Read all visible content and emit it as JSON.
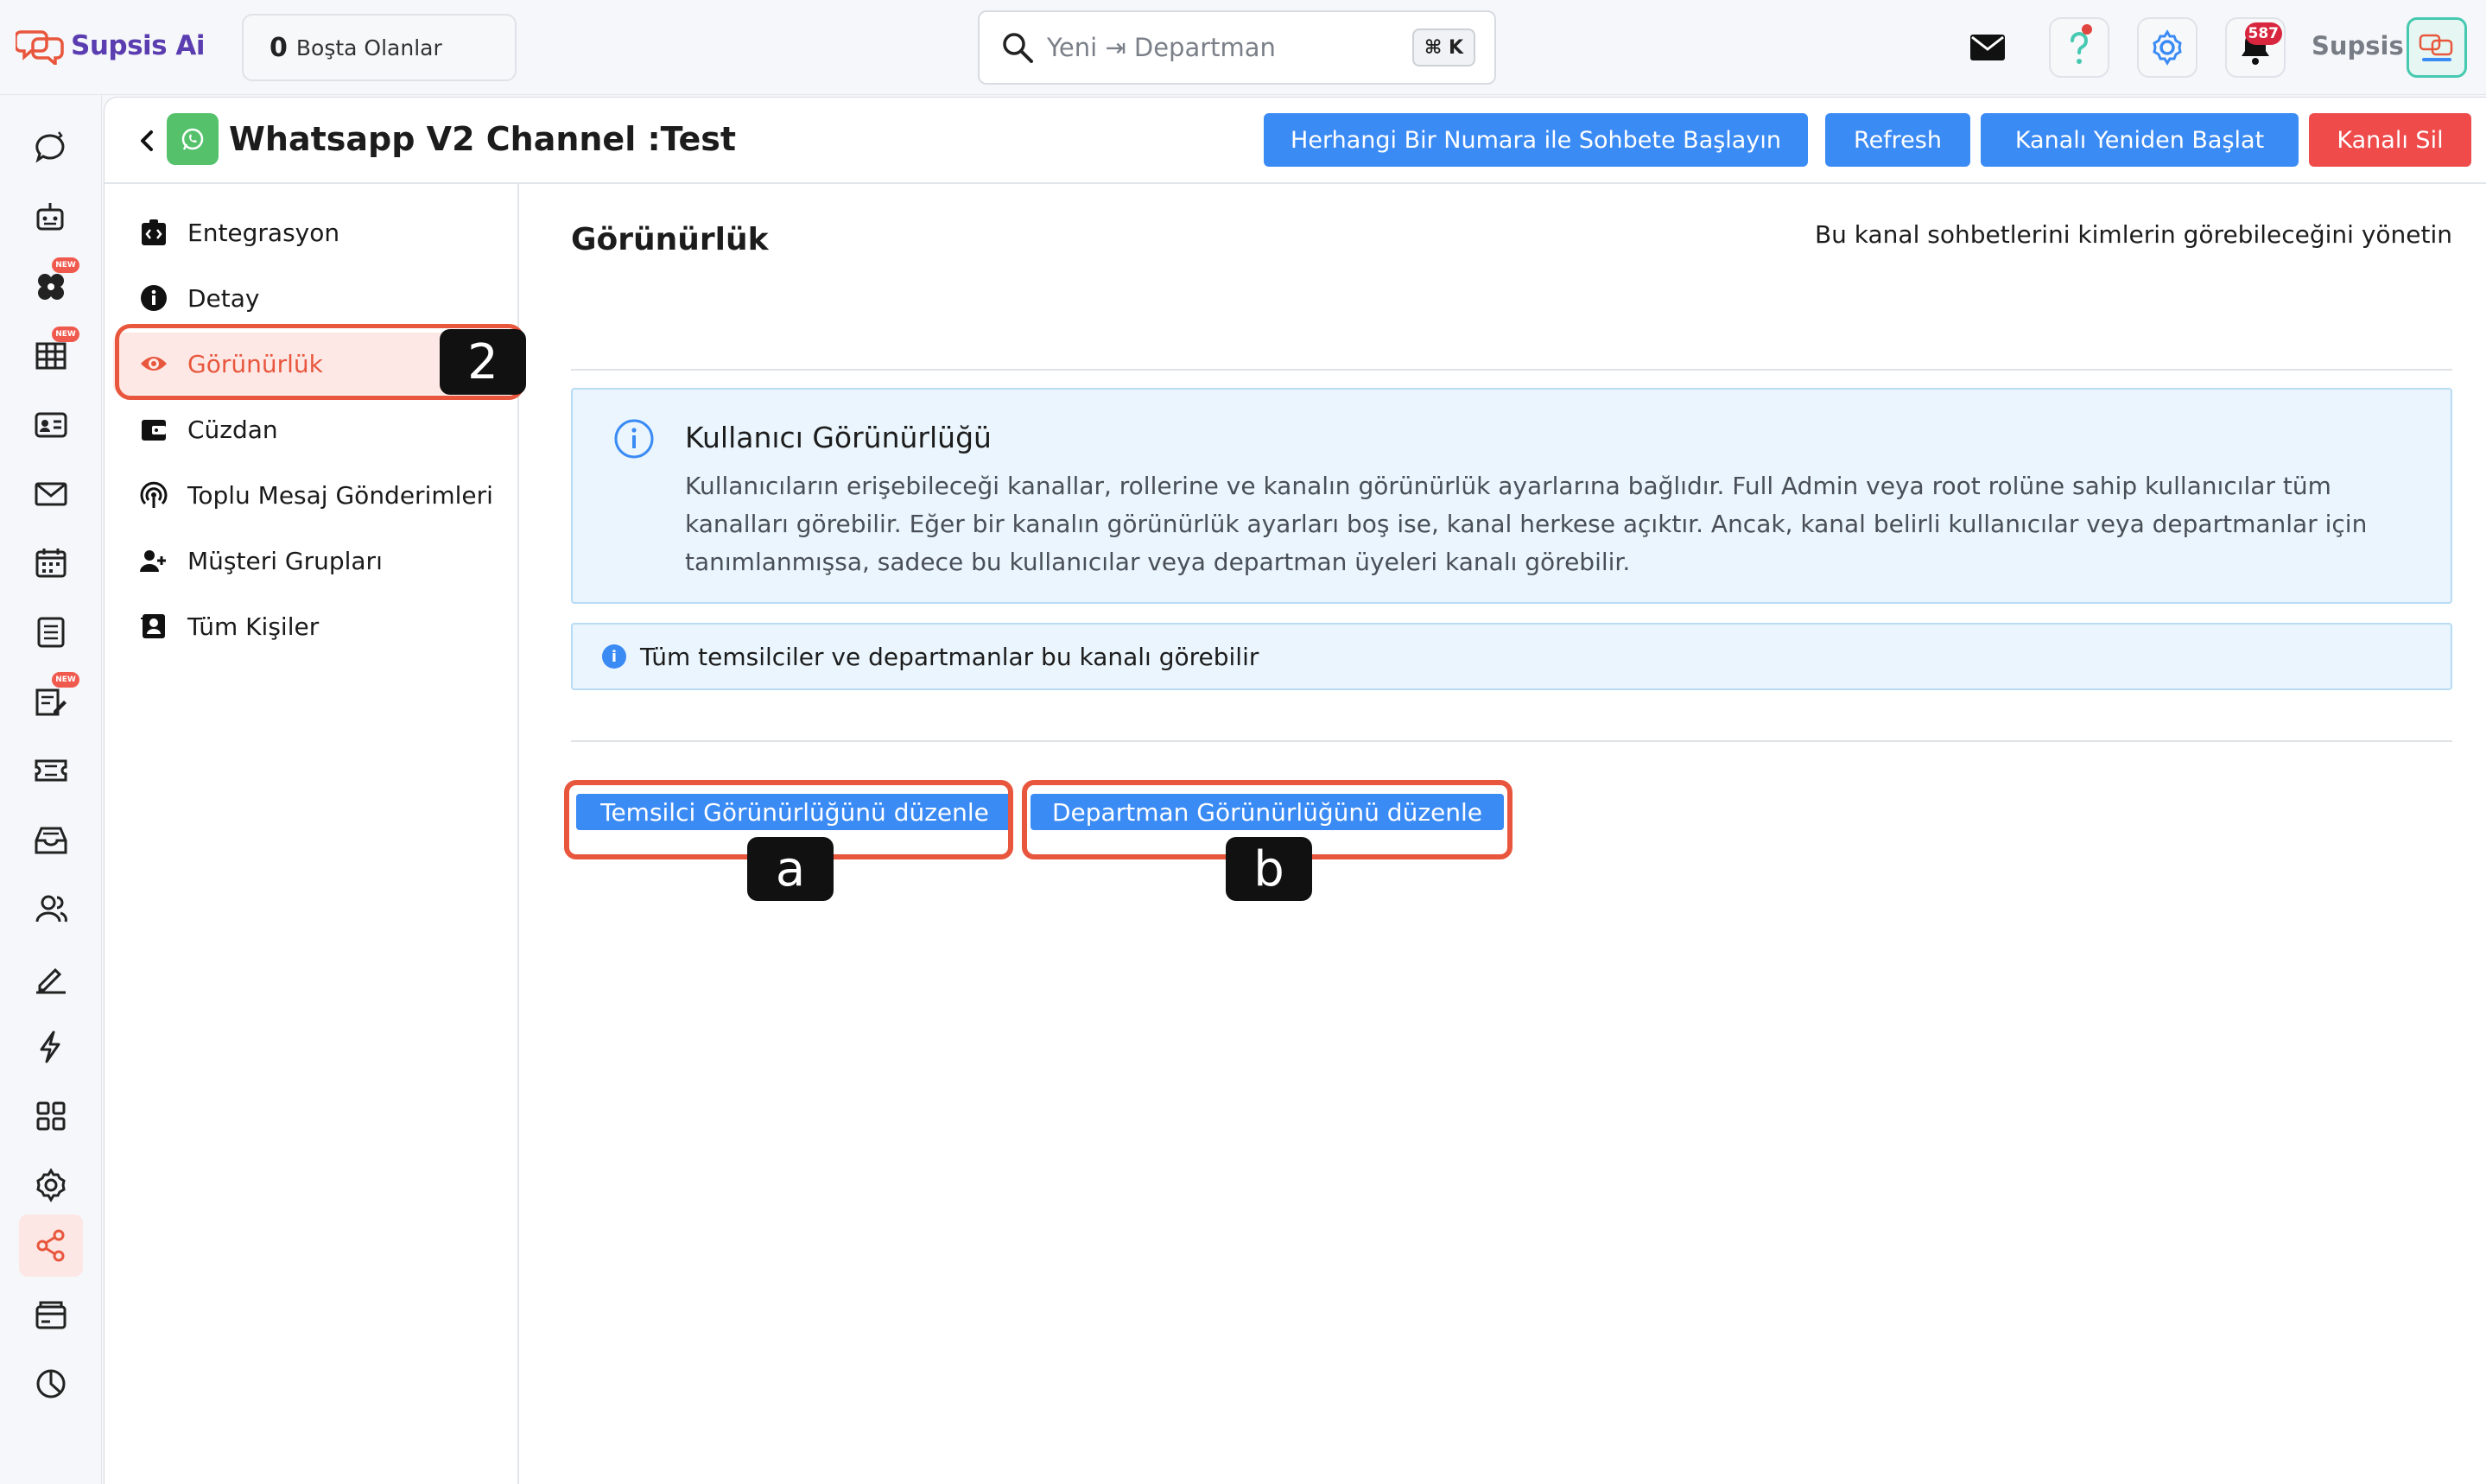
{
  "brand": {
    "name": "Supsis Ai"
  },
  "topbar": {
    "idle_count": "0",
    "idle_label": "Boşta Olanlar",
    "search_placeholder": "Yeni ⇥ Departman",
    "search_shortcut": "⌘ K",
    "notification_count": "587",
    "user_name": "Supsis"
  },
  "rail": {
    "items": [
      {
        "icon": "chat-bubble-icon"
      },
      {
        "icon": "bot-icon"
      },
      {
        "icon": "ai-flower-icon",
        "badge": "NEW"
      },
      {
        "icon": "table-icon",
        "badge": "NEW"
      },
      {
        "icon": "contact-card-icon"
      },
      {
        "icon": "mail-icon"
      },
      {
        "icon": "calendar-icon"
      },
      {
        "icon": "list-icon"
      },
      {
        "icon": "form-edit-icon",
        "badge": "NEW"
      },
      {
        "icon": "ticket-icon"
      },
      {
        "icon": "inbox-icon"
      },
      {
        "icon": "users-icon"
      },
      {
        "icon": "sign-icon"
      },
      {
        "icon": "lightning-icon"
      },
      {
        "icon": "grid-icon"
      },
      {
        "icon": "settings-icon"
      },
      {
        "icon": "share-icon",
        "active": true
      },
      {
        "icon": "cards-icon"
      },
      {
        "icon": "pie-chart-icon"
      }
    ]
  },
  "header": {
    "title": "Whatsapp V2 Channel :Test",
    "buttons": {
      "start_chat": "Herhangi Bir Numara ile Sohbete Başlayın",
      "refresh": "Refresh",
      "restart": "Kanalı Yeniden Başlat",
      "delete": "Kanalı Sil"
    }
  },
  "subnav": {
    "items": [
      {
        "label": "Entegrasyon",
        "icon": "integration-icon"
      },
      {
        "label": "Detay",
        "icon": "info-icon"
      },
      {
        "label": "Görünürlük",
        "icon": "eye-icon",
        "active": true
      },
      {
        "label": "Cüzdan",
        "icon": "wallet-icon"
      },
      {
        "label": "Toplu Mesaj Gönderimleri",
        "icon": "broadcast-icon"
      },
      {
        "label": "Müşteri Grupları",
        "icon": "user-group-icon"
      },
      {
        "label": "Tüm Kişiler",
        "icon": "contacts-icon"
      }
    ]
  },
  "markers": {
    "step": "2",
    "a": "a",
    "b": "b"
  },
  "content": {
    "title": "Görünürlük",
    "description": "Bu kanal sohbetlerini kimlerin görebileceğini yönetin",
    "info_title": "Kullanıcı Görünürlüğü",
    "info_body": "Kullanıcıların erişebileceği kanallar, rollerine ve kanalın görünürlük ayarlarına bağlıdır. Full Admin veya root rolüne sahip kullanıcılar tüm kanalları görebilir. Eğer bir kanalın görünürlük ayarları boş ise, kanal herkese açıktır. Ancak, kanal belirli kullanıcılar veya departmanlar için tanımlanmışsa, sadece bu kullanıcılar veya departman üyeleri kanalı görebilir.",
    "visibility_status": "Tüm temsilciler ve departmanlar bu kanalı görebilir",
    "edit_agent_visibility": "Temsilci Görünürlüğünü düzenle",
    "edit_department_visibility": "Departman Görünürlüğünü düzenle"
  },
  "colors": {
    "accent_blue": "#3b8bf5",
    "danger_red": "#ef4b4b",
    "highlight_orange": "#e8573d",
    "info_bg": "#eaf5fd"
  }
}
